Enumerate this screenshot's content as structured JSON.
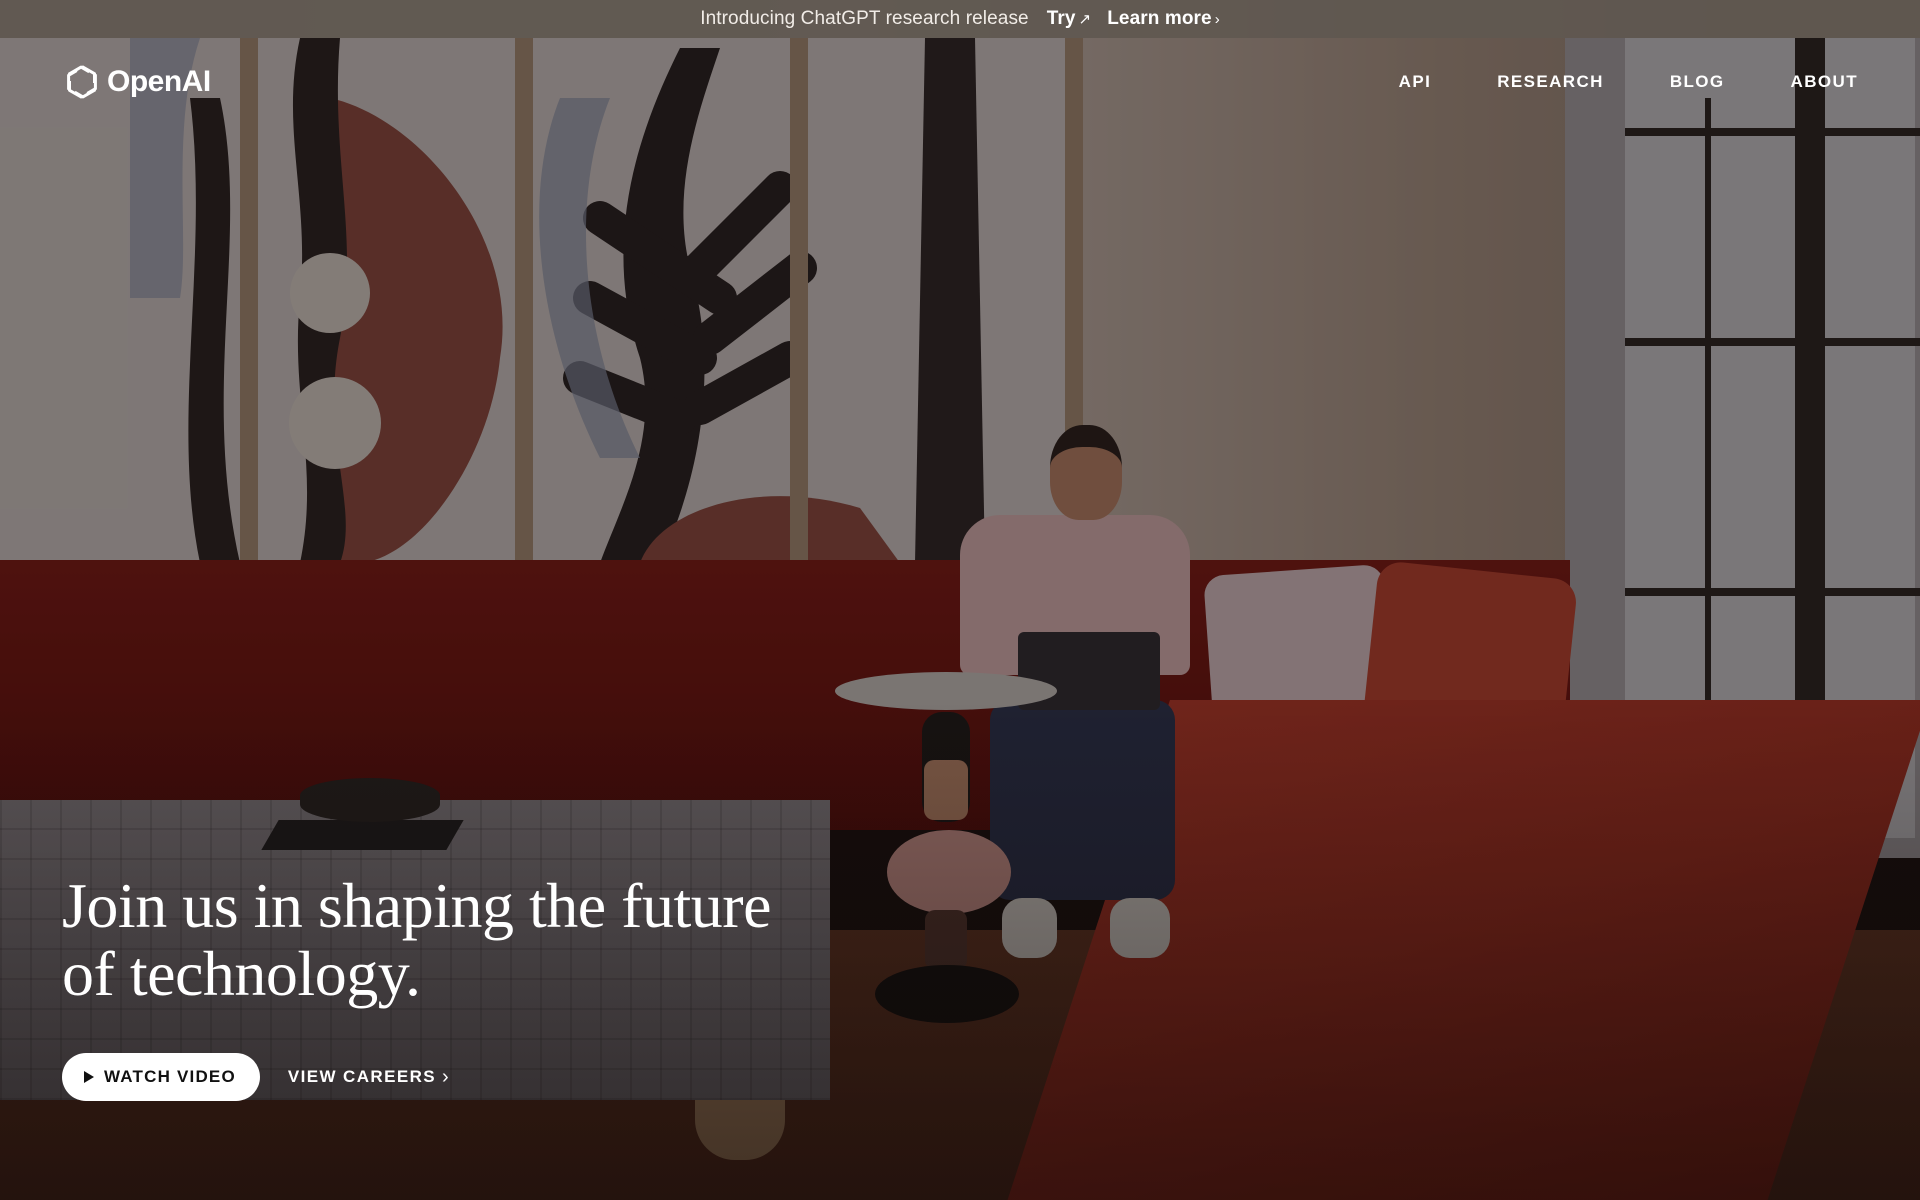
{
  "announcement": {
    "message": "Introducing ChatGPT research release",
    "try_label": "Try",
    "try_glyph": "↗",
    "learn_label": "Learn more",
    "learn_glyph": "›"
  },
  "brand": {
    "name": "OpenAI",
    "logo_icon": "openai-logo-icon"
  },
  "nav": {
    "items": [
      {
        "label": "API"
      },
      {
        "label": "RESEARCH"
      },
      {
        "label": "BLOG"
      },
      {
        "label": "ABOUT"
      }
    ]
  },
  "hero": {
    "title_line1": "Join us in shaping the future",
    "title_line2": "of technology.",
    "watch_label": "WATCH VIDEO",
    "watch_icon": "play-icon",
    "careers_label": "VIEW CAREERS",
    "careers_glyph": "›"
  },
  "colors": {
    "announcement_bg": "#605850",
    "text": "#ffffff",
    "button_bg": "#ffffff",
    "button_text": "#111111"
  }
}
